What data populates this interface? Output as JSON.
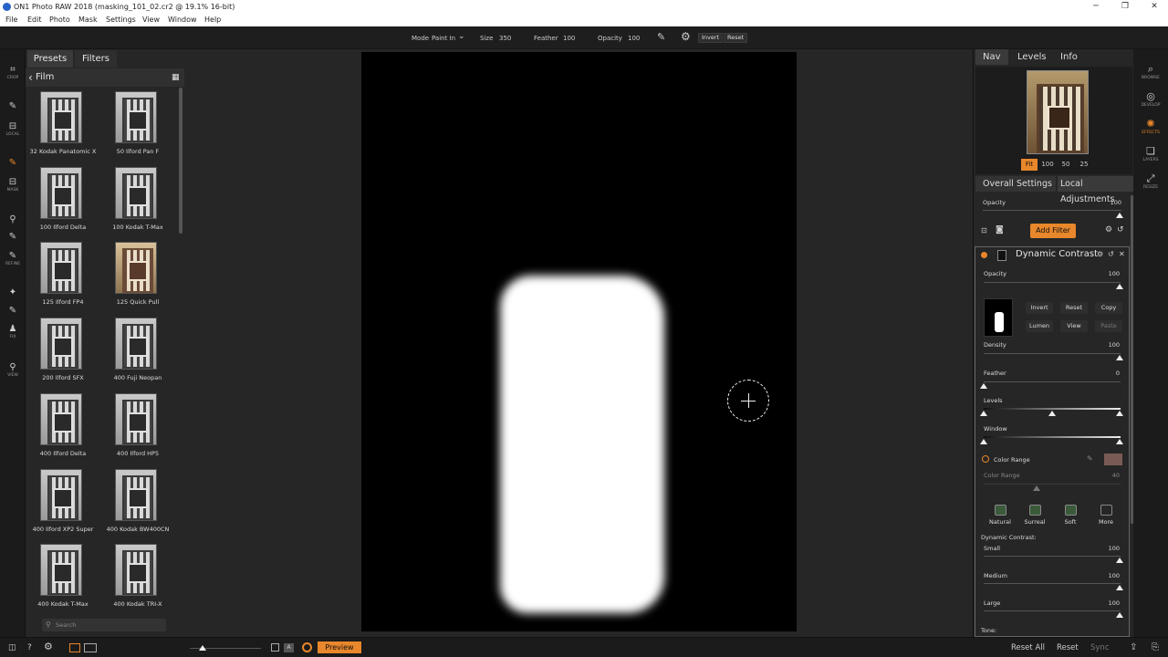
{
  "window": {
    "title": "ON1 Photo RAW 2018 (masking_101_02.cr2 @ 19.1% 16-bit)",
    "minimize": "─",
    "maximize": "❐",
    "close": "✕"
  },
  "menu": [
    "File",
    "Edit",
    "Photo",
    "Mask",
    "Settings",
    "View",
    "Window",
    "Help"
  ],
  "toolbar": {
    "mode_label": "Mode",
    "mode_value": "Paint In",
    "size_label": "Size",
    "size_value": "350",
    "feather_label": "Feather",
    "feather_value": "100",
    "opacity_label": "Opacity",
    "opacity_value": "100",
    "invert": "Invert",
    "reset": "Reset"
  },
  "tools": [
    {
      "icon": "⌗",
      "label": "CROP"
    },
    {
      "icon": "✎",
      "label": ""
    },
    {
      "icon": "⊟",
      "label": "LOCAL"
    },
    {
      "icon": "✎",
      "label": ""
    },
    {
      "icon": "⊟",
      "label": "MASK"
    },
    {
      "icon": "⚲",
      "label": ""
    },
    {
      "icon": "✎",
      "label": ""
    },
    {
      "icon": "✎",
      "label": "REFINE"
    },
    {
      "icon": "✦",
      "label": ""
    },
    {
      "icon": "✎",
      "label": ""
    },
    {
      "icon": "♟",
      "label": "FIX"
    },
    {
      "icon": "⚲",
      "label": "VIEW"
    }
  ],
  "left_panel": {
    "tabs": [
      "Presets",
      "Filters"
    ],
    "breadcrumb": "Film",
    "back_icon": "‹",
    "grid_icon": "▦",
    "presets": [
      "32 Kodak Panatomic X",
      "50 Ilford Pan F",
      "100 Ilford Delta",
      "100 Kodak T-Max",
      "125 Ilford FP4",
      "125 Quick Pull",
      "200 Ilford SFX",
      "400 Fuji Neopan",
      "400 Ilford Delta",
      "400 Ilford HP5",
      "400 Ilford XP2 Super",
      "400 Kodak BW400CN",
      "400 Kodak T-Max",
      "400 Kodak TRI-X"
    ],
    "search_placeholder": "Search"
  },
  "right_panel": {
    "tabs": [
      "Nav",
      "Levels",
      "Info"
    ],
    "zoom": [
      "Fit",
      "100",
      "50",
      "25"
    ],
    "settings_tabs": [
      "Overall Settings",
      "Local Adjustments"
    ],
    "opacity_label": "Opacity",
    "opacity_value": "100",
    "add_filter": "Add Filter",
    "filter": {
      "name": "Dynamic Contrast",
      "opacity_label": "Opacity",
      "opacity_value": "100",
      "buttons": [
        "Invert",
        "Reset",
        "Copy",
        "Lumen",
        "View",
        "Paste"
      ],
      "density_label": "Density",
      "density_value": "100",
      "feather_label": "Feather",
      "feather_value": "0",
      "levels_label": "Levels",
      "window_label": "Window",
      "color_range_toggle": "Color Range",
      "color_range_label": "Color Range",
      "color_range_value": "40",
      "modes": [
        "Natural",
        "Surreal",
        "Soft",
        "More"
      ],
      "dc_label": "Dynamic Contrast:",
      "small_label": "Small",
      "small_value": "100",
      "medium_label": "Medium",
      "medium_value": "100",
      "large_label": "Large",
      "large_value": "100",
      "tone_label": "Tone:"
    }
  },
  "modules": [
    {
      "icon": "⌕",
      "label": "BROWSE"
    },
    {
      "icon": "◎",
      "label": "DEVELOP"
    },
    {
      "icon": "✺",
      "label": "EFFECTS"
    },
    {
      "icon": "❏",
      "label": "LAYERS"
    },
    {
      "icon": "⤢",
      "label": "RESIZE"
    }
  ],
  "status": {
    "preview": "Preview",
    "reset_all": "Reset All",
    "reset": "Reset",
    "sync": "Sync"
  },
  "colors": {
    "accent": "#e8872b",
    "canvas": "#000000",
    "panel": "#262626"
  }
}
